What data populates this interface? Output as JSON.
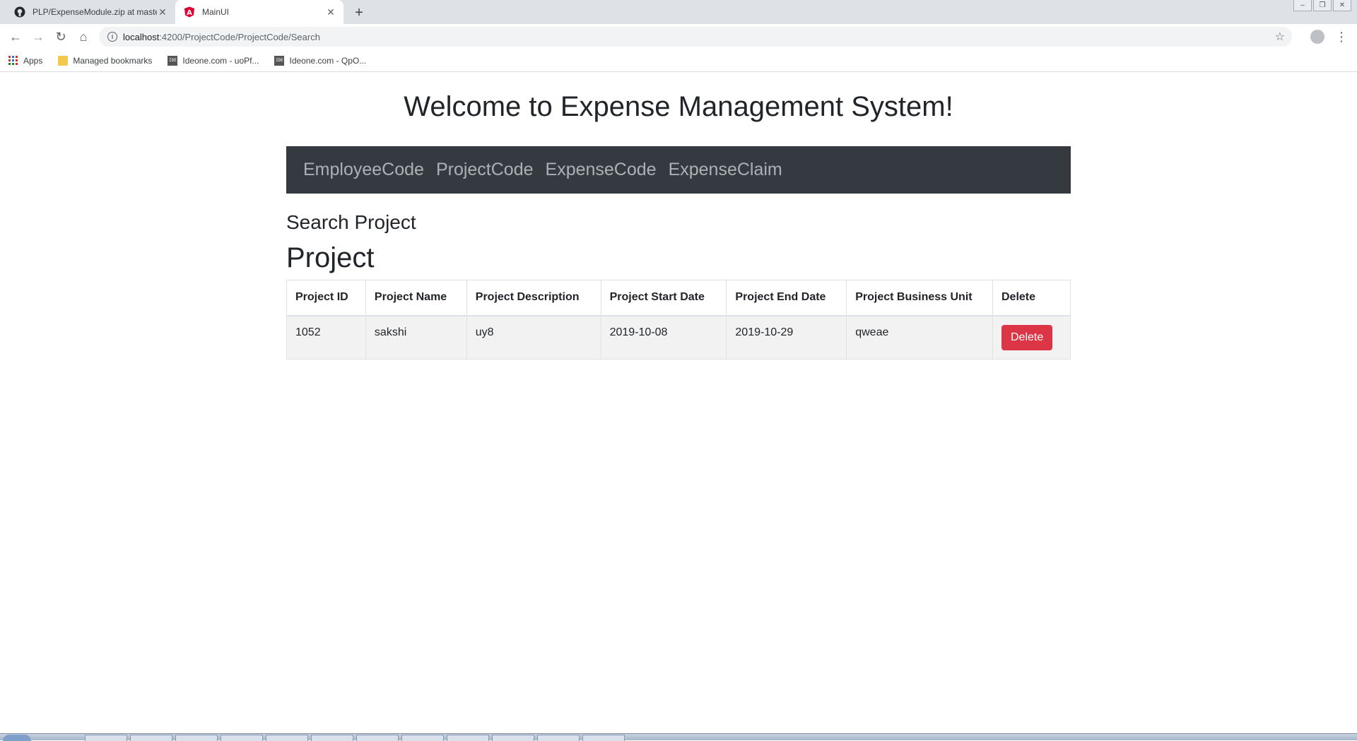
{
  "browser": {
    "tabs": [
      {
        "title": "PLP/ExpenseModule.zip at maste",
        "icon": "github-icon",
        "active": false
      },
      {
        "title": "MainUI",
        "icon": "angular-icon",
        "active": true
      }
    ],
    "new_tab_icon": "plus-icon",
    "url_host": "localhost",
    "url_path": ":4200/ProjectCode/ProjectCode/Search",
    "bookmarks": [
      {
        "label": "Apps",
        "icon": "apps-grid-icon"
      },
      {
        "label": "Managed bookmarks",
        "icon": "folder-icon"
      },
      {
        "label": "Ideone.com - uoPf...",
        "icon": "ideone-icon"
      },
      {
        "label": "Ideone.com - QpO...",
        "icon": "ideone-icon"
      }
    ]
  },
  "page": {
    "welcome_title": "Welcome to Expense Management System!",
    "nav": [
      "EmployeeCode",
      "ProjectCode",
      "ExpenseCode",
      "ExpenseClaim"
    ],
    "section_title": "Search Project",
    "heading": "Project",
    "table": {
      "headers": [
        "Project ID",
        "Project Name",
        "Project Description",
        "Project Start Date",
        "Project End Date",
        "Project Business Unit",
        "Delete"
      ],
      "rows": [
        [
          "1052",
          "sakshi",
          "uy8",
          "2019-10-08",
          "2019-10-29",
          "qweae"
        ]
      ],
      "delete_label": "Delete"
    }
  },
  "colors": {
    "navbar_bg": "#343a40",
    "danger": "#dc3545",
    "row_bg": "#f2f2f2"
  }
}
